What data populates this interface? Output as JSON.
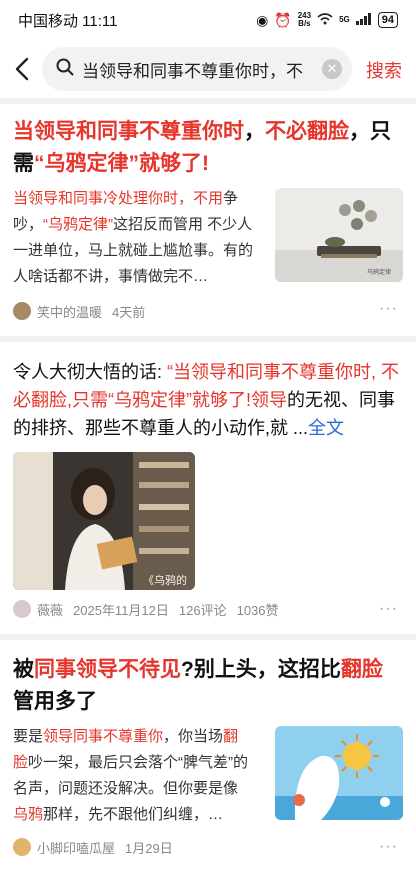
{
  "status_bar": {
    "carrier_time": "中国移动 11:11",
    "net_speed_top": "243",
    "net_speed_bottom": "B/s",
    "signal_label": "5G",
    "battery": "94"
  },
  "search": {
    "query": "当领导和同事不尊重你时，不",
    "button_label": "搜索"
  },
  "results": [
    {
      "title_red1": "当领导和同事不尊重你时",
      "title_mid": "，",
      "title_red2": "不必翻脸",
      "title_mid2": "，只需",
      "title_red3": "“乌鸦定律”就够了!",
      "snippet_red1": "当领导和同事冷处理你时，不用",
      "snippet_1": "争吵，",
      "snippet_red2": "“乌鸦定律”",
      "snippet_2": "这招反而管用 不少人一进单位，马上就碰上尴尬事。有的人啥话都不讲，事情做完不…",
      "author": "笑中的温暖",
      "time": "4天前",
      "thumb_caption": "乌鸦定律"
    },
    {
      "body_1": "令人大彻大悟的话: ",
      "body_red": "“当领导和同事不尊重你时, 不必翻脸,只需“乌鸦定律”就够了!领导",
      "body_2": "的无视、同事的排挤、那些不尊重人的小动作,就",
      "ellipsis": "...",
      "full_text_link": "全文",
      "image_caption": "《乌鸦的",
      "author": "薇薇",
      "date": "2025年11月12日",
      "comments": "126评论",
      "likes": "1036赞"
    },
    {
      "title_1": "被",
      "title_red1": "同事领导不待见",
      "title_2": "?别上头，这招比",
      "title_red2": "翻脸",
      "title_3": "管用多了",
      "snippet_1": "要是",
      "snippet_red1": "领导同事不尊重你",
      "snippet_2": "，你当场",
      "snippet_red2": "翻脸",
      "snippet_3": "吵一架，最后只会落个“脾气差”的名声，问题还没解决。但你要是像",
      "snippet_red3": "乌鸦",
      "snippet_4": "那样，先不跟他们纠缠，…",
      "author": "小脚印嗑瓜屋",
      "time": "1月29日"
    }
  ],
  "more_label": "···",
  "colors": {
    "accent_red": "#e5352c",
    "link_blue": "#2b6bd6",
    "meta_gray": "#888888"
  }
}
